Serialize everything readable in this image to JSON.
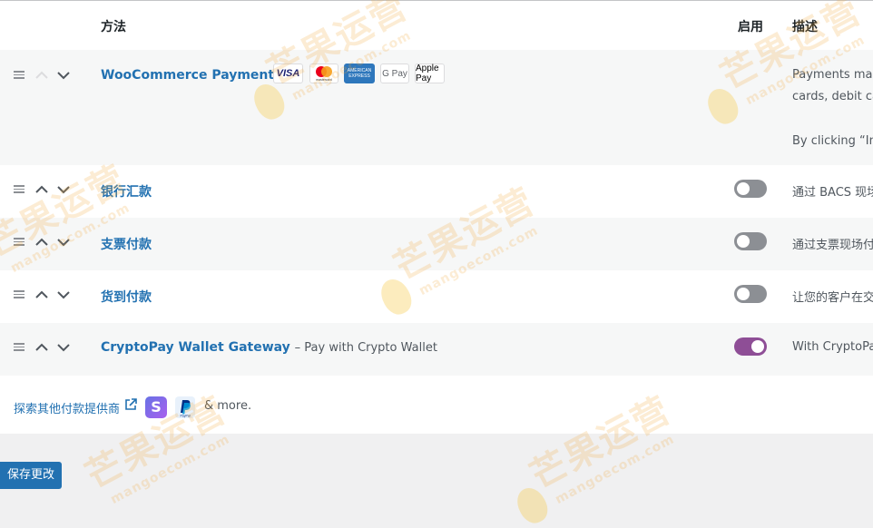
{
  "table": {
    "headers": {
      "method": "方法",
      "enabled": "启用",
      "description": "描述"
    },
    "rows": [
      {
        "name": "WooCommerce Payments",
        "description_lines": [
          "Payments mad",
          "cards, debit ca",
          "By clicking “Ins"
        ],
        "card_logos": [
          "VISA",
          "mastercard",
          "AMERICAN EXPRESS",
          "G Pay",
          "Apple Pay"
        ]
      },
      {
        "name": "银行汇款",
        "enabled": false,
        "description": "通过 BACS 现场"
      },
      {
        "name": "支票付款",
        "enabled": false,
        "description": "通过支票现场付"
      },
      {
        "name": "货到付款",
        "enabled": false,
        "description": "让您的客户在交"
      },
      {
        "name": "CryptoPay Wallet Gateway",
        "subtitle": "– Pay with Crypto Wallet",
        "enabled": true,
        "description": "With CryptoPa"
      }
    ]
  },
  "footer": {
    "explore_link": "探索其他付款提供商",
    "stripe_letter": "S",
    "paypal_label": "PayPal",
    "more_text": "& more."
  },
  "save_button": "保存更改",
  "watermark": {
    "text": "芒果运营",
    "url": "mangoecom.com"
  },
  "colors": {
    "link": "#2271b1",
    "toggle_on": "#8e4e96",
    "toggle_off": "#8c8f94",
    "button": "#2271b1"
  }
}
